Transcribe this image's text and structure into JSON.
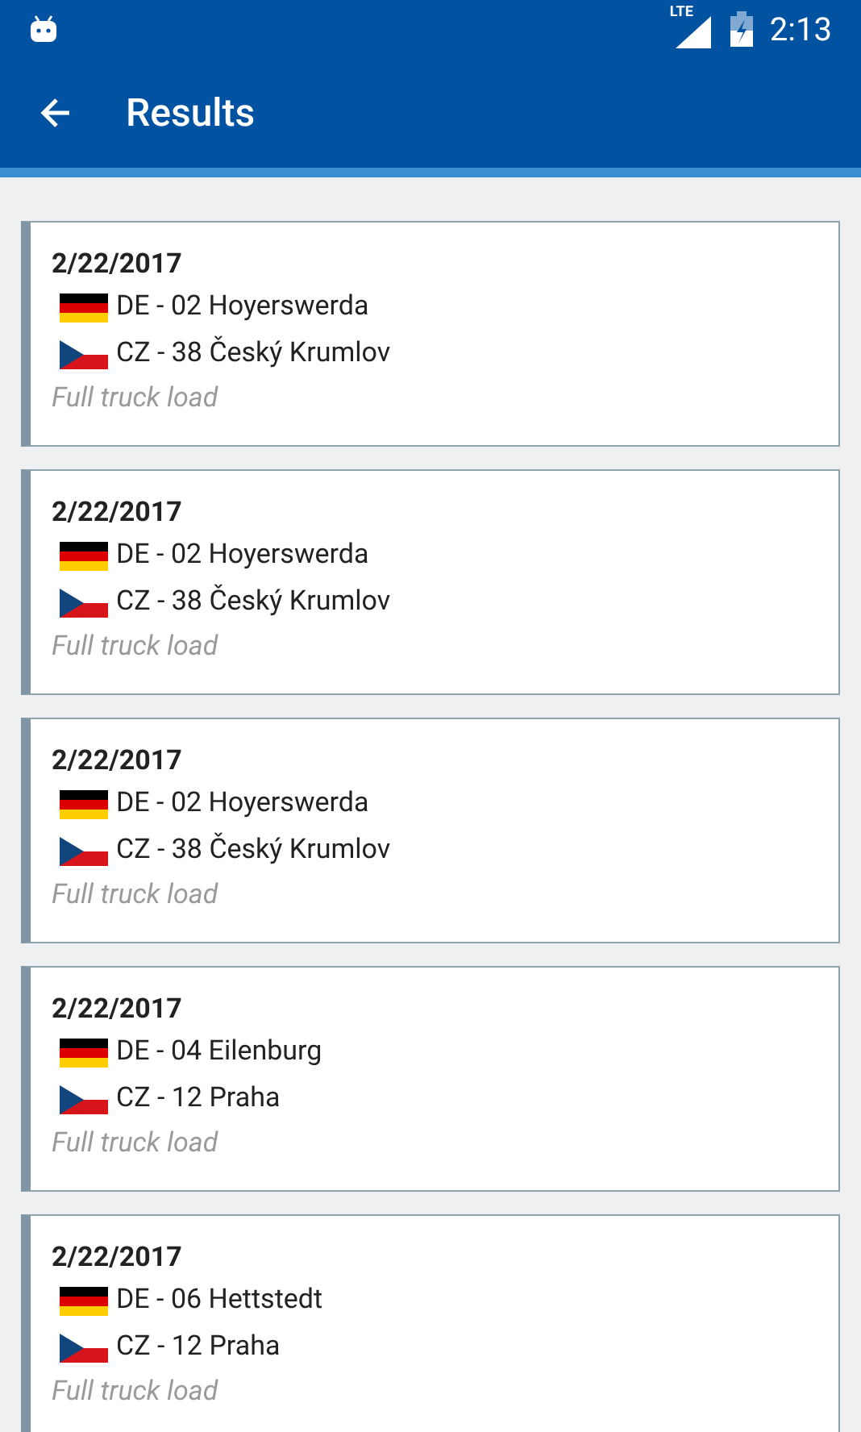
{
  "status_bar": {
    "time": "2:13",
    "network": "LTE"
  },
  "app_bar": {
    "title": "Results"
  },
  "results": [
    {
      "date": "2/22/2017",
      "stops": [
        {
          "kind": "de",
          "text": "DE - 02 Hoyerswerda"
        },
        {
          "kind": "cz",
          "text": "CZ - 38 Český Krumlov"
        }
      ],
      "load": "Full truck load"
    },
    {
      "date": "2/22/2017",
      "stops": [
        {
          "kind": "de",
          "text": "DE - 02 Hoyerswerda"
        },
        {
          "kind": "cz",
          "text": "CZ - 38 Český Krumlov"
        }
      ],
      "load": "Full truck load"
    },
    {
      "date": "2/22/2017",
      "stops": [
        {
          "kind": "de",
          "text": "DE - 02 Hoyerswerda"
        },
        {
          "kind": "cz",
          "text": "CZ - 38 Český Krumlov"
        }
      ],
      "load": "Full truck load"
    },
    {
      "date": "2/22/2017",
      "stops": [
        {
          "kind": "de",
          "text": "DE - 04 Eilenburg"
        },
        {
          "kind": "cz",
          "text": "CZ - 12 Praha"
        }
      ],
      "load": "Full truck load"
    },
    {
      "date": "2/22/2017",
      "stops": [
        {
          "kind": "de",
          "text": "DE - 06 Hettstedt"
        },
        {
          "kind": "cz",
          "text": "CZ - 12 Praha"
        }
      ],
      "load": "Full truck load"
    }
  ]
}
